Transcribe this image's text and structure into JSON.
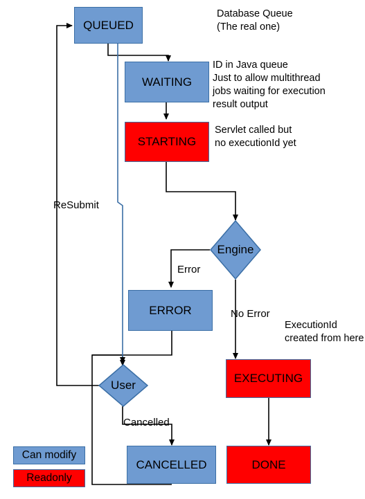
{
  "diagram": {
    "title_colors": {
      "can_modify": "#6f9bd1",
      "readonly": "#ff0000",
      "node_border": "#3a6ea5",
      "edge_black": "#000000",
      "edge_blue": "#3a6ea5"
    },
    "nodes": [
      {
        "id": "queued",
        "label": "QUEUED",
        "shape": "rect",
        "kind": "modify"
      },
      {
        "id": "waiting",
        "label": "WAITING",
        "shape": "rect",
        "kind": "modify"
      },
      {
        "id": "starting",
        "label": "STARTING",
        "shape": "rect",
        "kind": "readonly"
      },
      {
        "id": "engine",
        "label": "Engine",
        "shape": "diamond",
        "kind": "modify"
      },
      {
        "id": "error",
        "label": "ERROR",
        "shape": "rect",
        "kind": "modify"
      },
      {
        "id": "executing",
        "label": "EXECUTING",
        "shape": "rect",
        "kind": "readonly"
      },
      {
        "id": "user",
        "label": "User",
        "shape": "diamond",
        "kind": "modify"
      },
      {
        "id": "cancelled",
        "label": "CANCELLED",
        "shape": "rect",
        "kind": "modify"
      },
      {
        "id": "done",
        "label": "DONE",
        "shape": "rect",
        "kind": "readonly"
      }
    ],
    "notes": [
      {
        "id": "note-queued",
        "text": "Database Queue\n(The real one)"
      },
      {
        "id": "note-waiting",
        "text": "ID in Java queue\nJust to allow multithread\njobs waiting for execution\nresult output"
      },
      {
        "id": "note-starting",
        "text": "Servlet called but\nno executionId yet"
      },
      {
        "id": "note-execid",
        "text": "ExecutionId\ncreated from here"
      }
    ],
    "edge_labels": [
      {
        "id": "label-resubmit",
        "text": "ReSubmit"
      },
      {
        "id": "label-error",
        "text": "Error"
      },
      {
        "id": "label-no-error",
        "text": "No Error"
      },
      {
        "id": "label-cancelled",
        "text": "Cancelled"
      }
    ],
    "legend": [
      {
        "id": "legend-can-modify",
        "label": "Can modify",
        "kind": "modify"
      },
      {
        "id": "legend-readonly",
        "label": "Readonly",
        "kind": "readonly"
      }
    ]
  }
}
